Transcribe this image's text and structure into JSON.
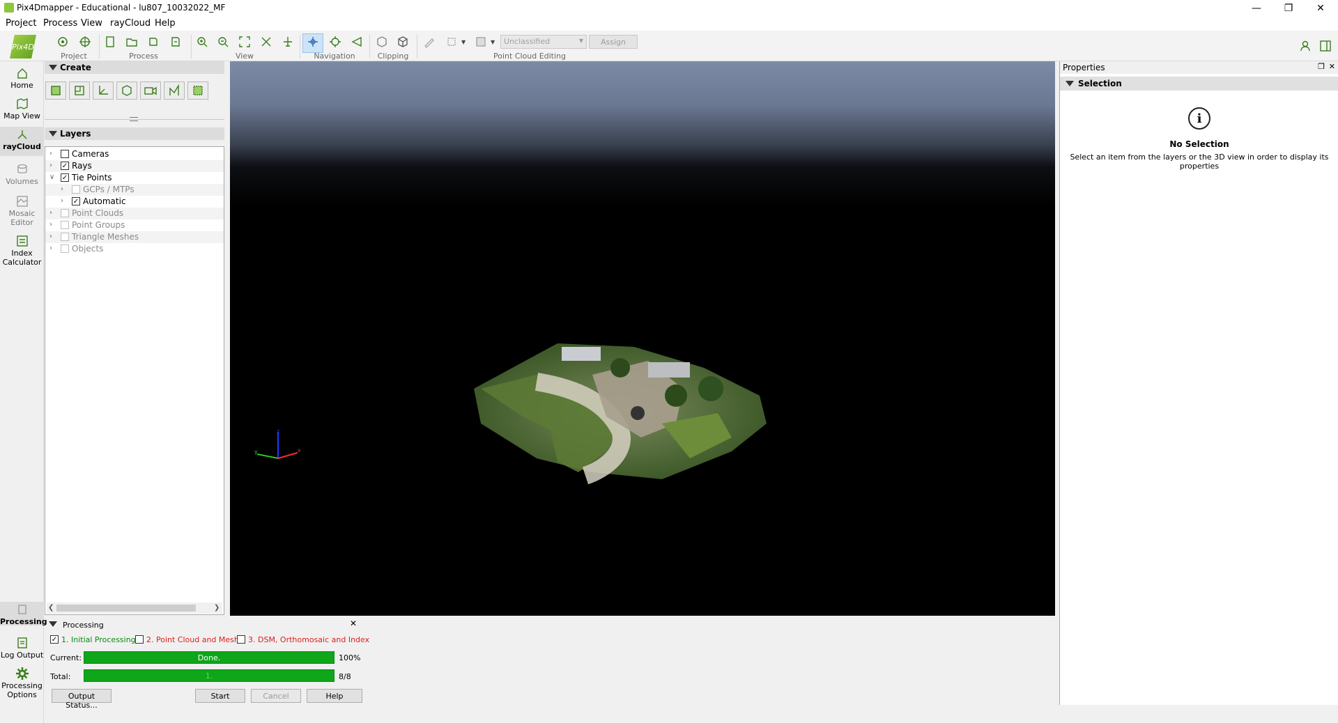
{
  "window": {
    "title": "Pix4Dmapper - Educational - lu807_10032022_MF",
    "minimize_icon": "minimize-icon",
    "restore_icon": "restore-icon",
    "close_icon": "close-icon"
  },
  "menu": [
    "Project",
    "Process",
    "View",
    "rayCloud",
    "Help"
  ],
  "toolbar": {
    "logo_text": "Pix4D",
    "groups": {
      "project": "Project",
      "process": "Process",
      "view": "View",
      "navigation": "Navigation",
      "clipping": "Clipping",
      "editing": "Point Cloud Editing"
    },
    "class_dropdown": "Unclassified",
    "assign_label": "Assign"
  },
  "leftnav": {
    "home": "Home",
    "map_view": "Map View",
    "raycloud": "rayCloud",
    "volumes": "Volumes",
    "mosaic_editor_1": "Mosaic",
    "mosaic_editor_2": "Editor",
    "index_calc_1": "Index",
    "index_calc_2": "Calculator",
    "processing": "Processing",
    "log_output": "Log Output",
    "proc_options_1": "Processing",
    "proc_options_2": "Options"
  },
  "create": {
    "title": "Create"
  },
  "layers": {
    "title": "Layers",
    "items": [
      {
        "label": "Cameras",
        "checked": false,
        "indent": 0,
        "enabled": true,
        "expanded": false
      },
      {
        "label": "Rays",
        "checked": true,
        "indent": 0,
        "enabled": true,
        "expanded": false
      },
      {
        "label": "Tie Points",
        "checked": true,
        "indent": 0,
        "enabled": true,
        "expanded": true
      },
      {
        "label": "GCPs / MTPs",
        "checked": false,
        "indent": 1,
        "enabled": false,
        "expanded": false
      },
      {
        "label": "Automatic",
        "checked": true,
        "indent": 1,
        "enabled": true,
        "expanded": false
      },
      {
        "label": "Point Clouds",
        "checked": false,
        "indent": 0,
        "enabled": false,
        "expanded": false
      },
      {
        "label": "Point Groups",
        "checked": false,
        "indent": 0,
        "enabled": false,
        "expanded": false
      },
      {
        "label": "Triangle Meshes",
        "checked": false,
        "indent": 0,
        "enabled": false,
        "expanded": false
      },
      {
        "label": "Objects",
        "checked": false,
        "indent": 0,
        "enabled": false,
        "expanded": false
      }
    ]
  },
  "properties": {
    "title": "Properties",
    "section": "Selection",
    "info_icon": "i",
    "no_selection": "No Selection",
    "help": "Select an item from the layers or the 3D view in order to display its properties"
  },
  "processing": {
    "title": "Processing",
    "steps": [
      {
        "label": "1. Initial Processing",
        "checked": true,
        "color": "#0a8a14"
      },
      {
        "label": "2. Point Cloud and Mesh",
        "checked": false,
        "color": "#e01b1b"
      },
      {
        "label": "3. DSM, Orthomosaic and Index",
        "checked": false,
        "color": "#e01b1b"
      }
    ],
    "current_label": "Current:",
    "current_text": "Done.",
    "current_value": "100%",
    "current_progress": 1.0,
    "total_label": "Total:",
    "total_text": "1.",
    "total_value": "8/8",
    "total_progress": 1.0,
    "output_status": "Output Status...",
    "start": "Start",
    "cancel": "Cancel",
    "help": "Help"
  },
  "axes": {
    "x": "x",
    "y": "y",
    "z": "z"
  },
  "colors": {
    "accent": "#8dc63f",
    "progress": "#0fa61a"
  }
}
